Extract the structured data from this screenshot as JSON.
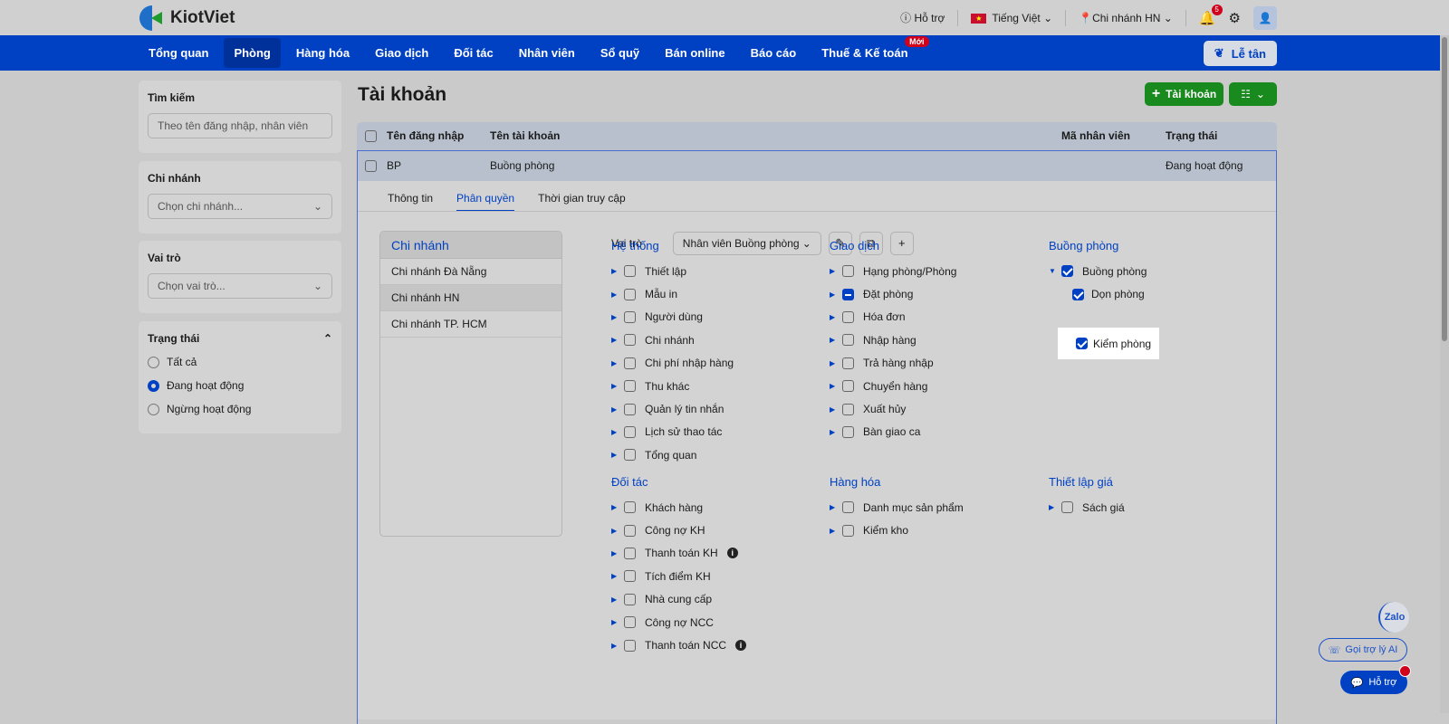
{
  "brand": "KiotViet",
  "topbar": {
    "support": "Hỗ trợ",
    "language": "Tiếng Việt",
    "branch": "Chi nhánh HN",
    "notifications": "5"
  },
  "nav": {
    "items": [
      "Tổng quan",
      "Phòng",
      "Hàng hóa",
      "Giao dịch",
      "Đối tác",
      "Nhân viên",
      "Sổ quỹ",
      "Bán online",
      "Báo cáo",
      "Thuế & Kế toán"
    ],
    "active": "Phòng",
    "new_badge": "Mới",
    "reception": "Lễ tân"
  },
  "sidebar": {
    "search": {
      "title": "Tìm kiếm",
      "placeholder": "Theo tên đăng nhập, nhân viên"
    },
    "branch": {
      "title": "Chi nhánh",
      "placeholder": "Chọn chi nhánh..."
    },
    "role": {
      "title": "Vai trò",
      "placeholder": "Chọn vai trò..."
    },
    "status": {
      "title": "Trạng thái",
      "options": [
        "Tất cả",
        "Đang hoạt động",
        "Ngừng hoạt động"
      ],
      "selected": "Đang hoạt động"
    }
  },
  "page": {
    "title": "Tài khoản",
    "add_button": "Tài khoản"
  },
  "table": {
    "headers": [
      "Tên đăng nhập",
      "Tên tài khoản",
      "Mã nhân viên",
      "Trạng thái"
    ],
    "rows": [
      {
        "username": "BP",
        "name": "Buồng phòng",
        "employee_code": "",
        "status": "Đang hoạt động"
      }
    ]
  },
  "detail": {
    "tabs": [
      "Thông tin",
      "Phân quyền",
      "Thời gian truy cập"
    ],
    "active_tab": "Phân quyền",
    "branches": {
      "title": "Chi nhánh",
      "items": [
        "Chi nhánh Đà Nẵng",
        "Chi nhánh HN",
        "Chi nhánh TP. HCM"
      ],
      "selected": "Chi nhánh HN"
    },
    "role_label": "Vai trò",
    "role_value": "Nhân viên Buồng phòng",
    "groups": [
      {
        "title": "Hệ thống",
        "items": [
          "Thiết lập",
          "Mẫu in",
          "Người dùng",
          "Chi nhánh",
          "Chi phí nhập hàng",
          "Thu khác",
          "Quản lý tin nhắn",
          "Lịch sử thao tác",
          "Tổng quan"
        ]
      },
      {
        "title": "Giao dịch",
        "items": [
          "Hạng phòng/Phòng",
          "Đặt phòng",
          "Hóa đơn",
          "Nhập hàng",
          "Trả hàng nhập",
          "Chuyển hàng",
          "Xuất hủy",
          "Bàn giao ca"
        ]
      },
      {
        "title": "Buồng phòng",
        "items": [
          "Buồng phòng",
          "Dọn phòng",
          "Kiểm phòng"
        ]
      },
      {
        "title": "Đối tác",
        "items": [
          "Khách hàng",
          "Công nợ KH",
          "Thanh toán KH",
          "Tích điểm KH",
          "Nhà cung cấp",
          "Công nợ NCC",
          "Thanh toán NCC"
        ]
      },
      {
        "title": "Hàng hóa",
        "items": [
          "Danh mục sản phẩm",
          "Kiểm kho"
        ]
      },
      {
        "title": "Thiết lập giá",
        "items": [
          "Sách giá"
        ]
      }
    ]
  },
  "float": {
    "zalo": "Zalo",
    "ai": "Gọi trợ lý AI",
    "support": "Hỗ trợ"
  }
}
